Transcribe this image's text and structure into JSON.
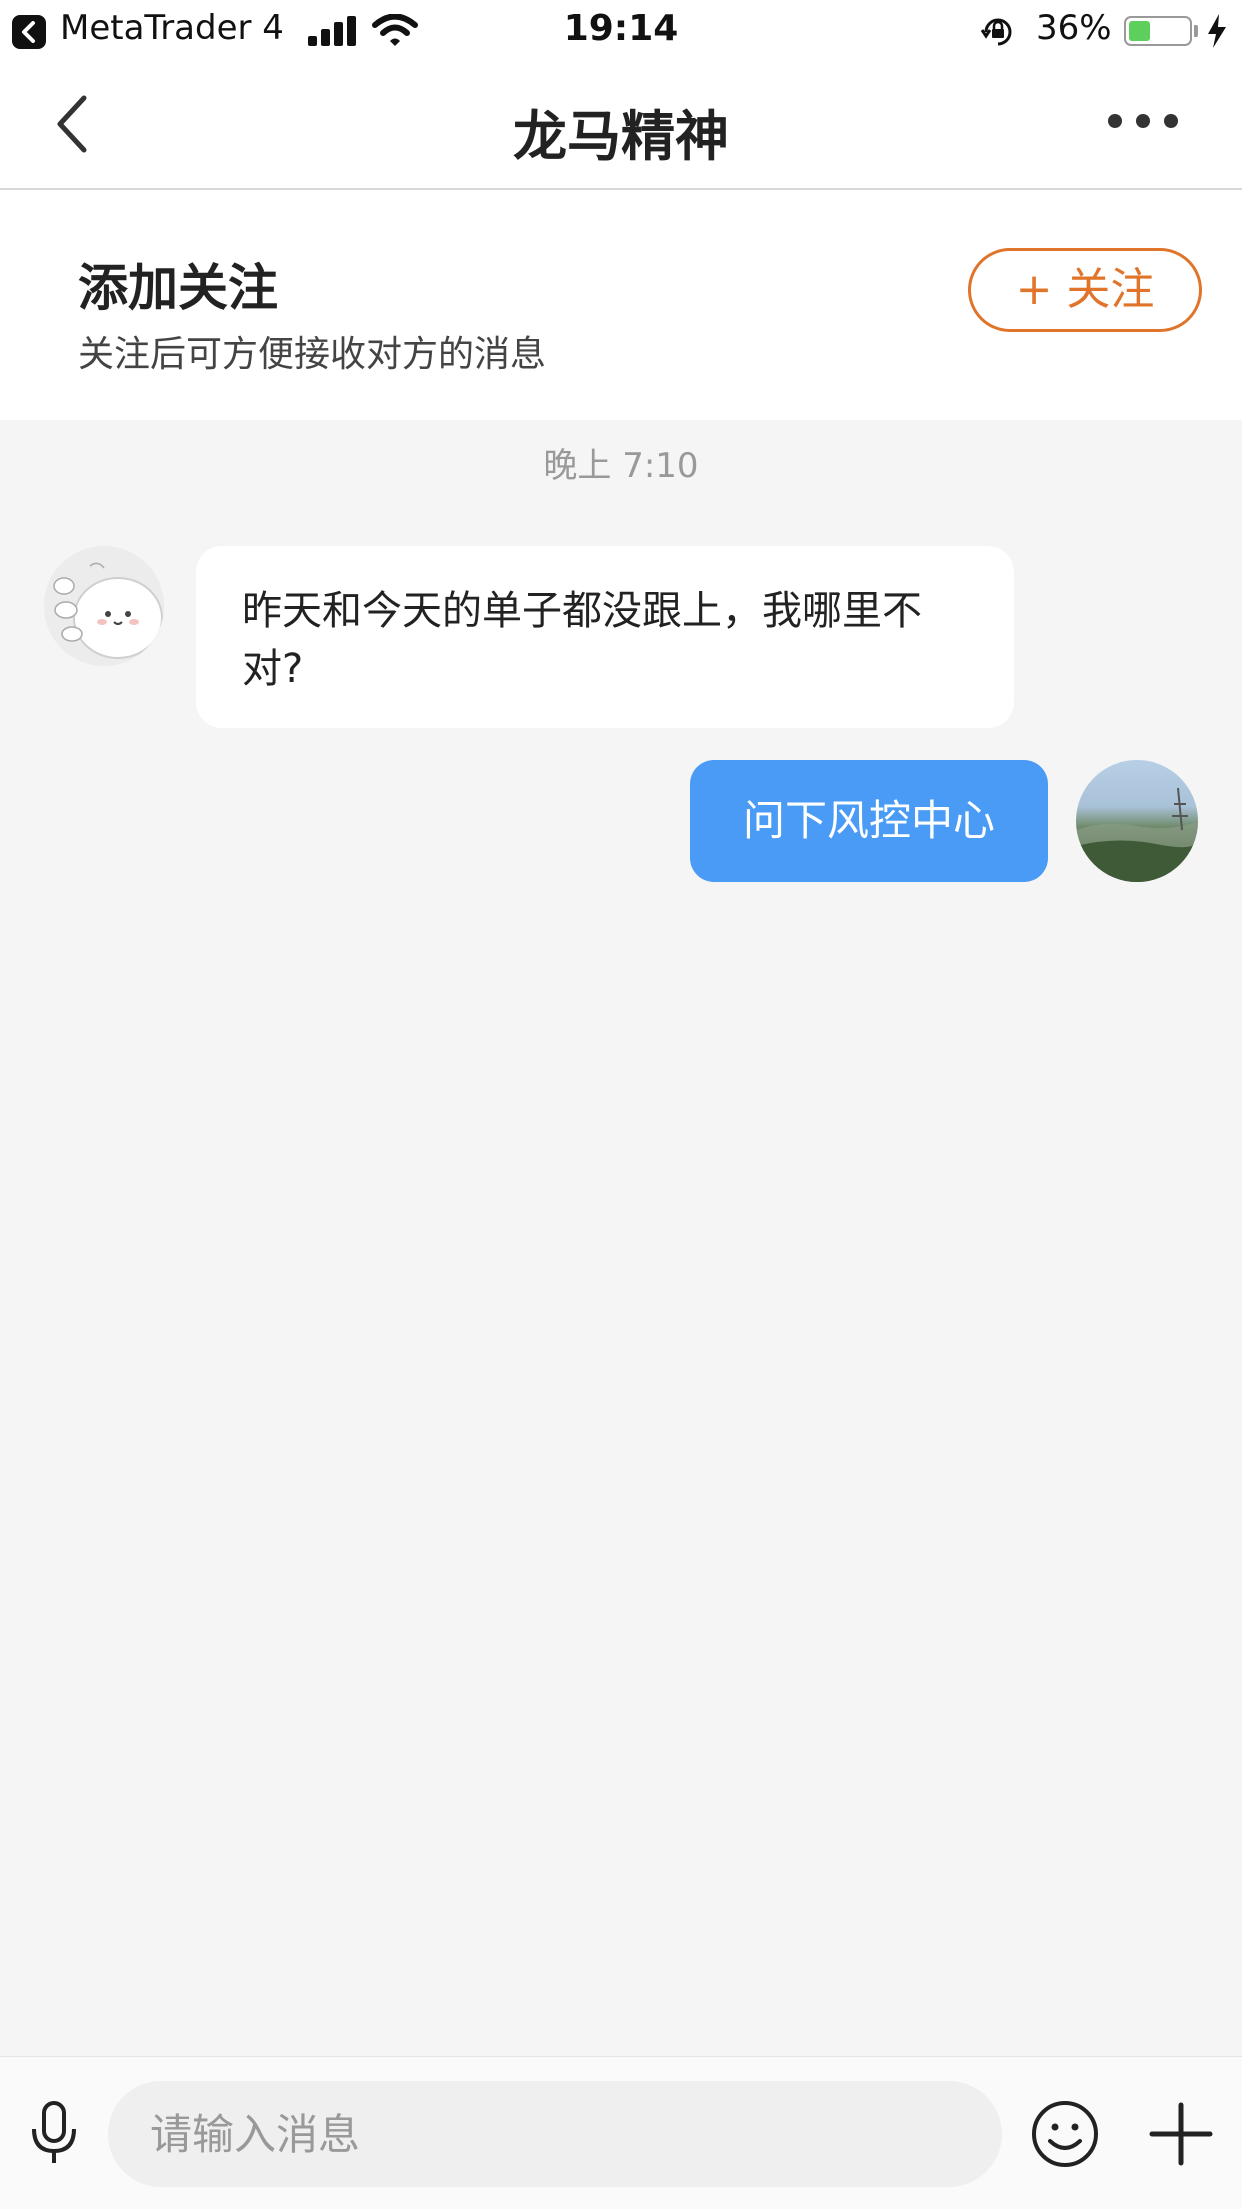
{
  "status_bar": {
    "back_app": "MetaTrader 4",
    "time": "19:14",
    "battery_percent": "36%",
    "battery_level": 0.36
  },
  "nav": {
    "title": "龙马精神"
  },
  "follow_banner": {
    "title": "添加关注",
    "subtitle": "关注后可方便接收对方的消息",
    "button_label": "+ 关注"
  },
  "chat": {
    "timestamp": "晚上 7:10",
    "messages": [
      {
        "side": "left",
        "text": "昨天和今天的单子都没跟上，我哪里不对?"
      },
      {
        "side": "right",
        "text": "问下风控中心"
      }
    ]
  },
  "input_bar": {
    "placeholder": "请输入消息"
  },
  "colors": {
    "accent_orange": "#e0742a",
    "bubble_blue": "#4a9bf5",
    "background": "#f5f5f5"
  },
  "icons": [
    "back-icon",
    "signal-icon",
    "wifi-icon",
    "rotation-lock-icon",
    "battery-icon",
    "charging-icon",
    "chevron-left-icon",
    "more-icon",
    "microphone-icon",
    "emoji-icon",
    "plus-icon"
  ]
}
